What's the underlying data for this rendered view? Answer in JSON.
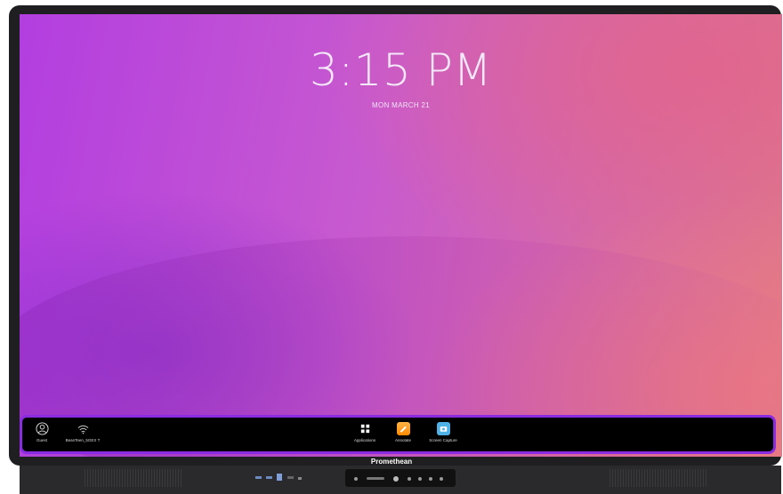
{
  "clock": {
    "time": "3:15 PM",
    "date": "MON MARCH 21"
  },
  "brand": {
    "name": "Promethean"
  },
  "taskbar": {
    "items": [
      {
        "label": "Guest",
        "icon": "user-icon"
      },
      {
        "label": "BeanTeen_5GEX T",
        "icon": "wifi-icon"
      },
      {
        "label": "Applications",
        "icon": "apps-grid-icon"
      },
      {
        "label": "Annotate",
        "icon": "annotate-icon"
      },
      {
        "label": "Screen Capture",
        "icon": "camera-icon"
      }
    ]
  },
  "colors": {
    "accent": "#8a2be2",
    "taskbar_bg": "#000000",
    "annotate": "#ff8a00",
    "capture": "#4fb2e6"
  }
}
